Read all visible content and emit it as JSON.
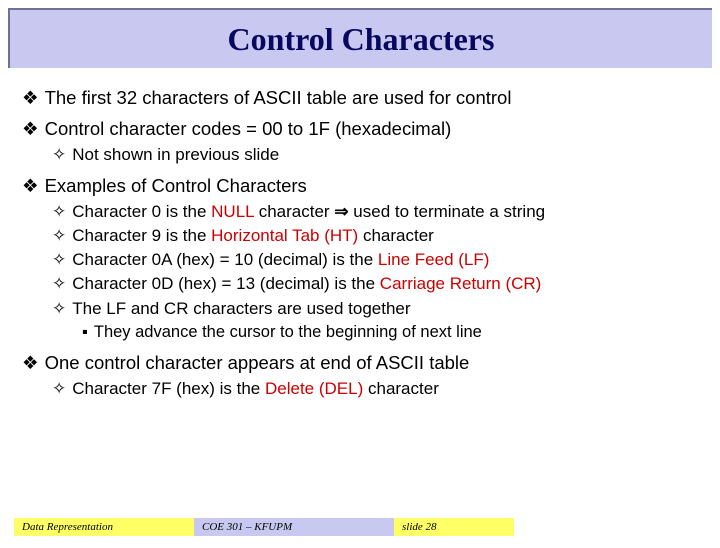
{
  "title": "Control Characters",
  "bullets": {
    "b1_1": "The first 32 characters of ASCII table are used for control",
    "b1_2": "Control character codes = 00 to 1F (hexadecimal)",
    "b2_1": "Not shown in previous slide",
    "b1_3": "Examples of Control Characters",
    "b2_2_a": "Character 0 is the ",
    "b2_2_hl": "NULL",
    "b2_2_b": " character ",
    "b2_2_arrow": "⇒",
    "b2_2_c": " used to terminate a string",
    "b2_3_a": "Character 9 is the ",
    "b2_3_hl": "Horizontal Tab (HT)",
    "b2_3_b": " character",
    "b2_4_a": "Character 0A (hex) = 10 (decimal) is the ",
    "b2_4_hl": "Line Feed (LF)",
    "b2_5_a": "Character 0D (hex) = 13 (decimal) is the ",
    "b2_5_hl": "Carriage Return (CR)",
    "b2_6": "The LF and CR characters are used together",
    "b3_1": "They advance the cursor to the beginning of next line",
    "b1_4": "One control character appears at end of ASCII table",
    "b2_7_a": "Character 7F (hex) is the ",
    "b2_7_hl": "Delete (DEL)",
    "b2_7_b": " character"
  },
  "footer": {
    "left": "Data Representation",
    "center": "COE 301 – KFUPM",
    "right": "slide 28"
  },
  "glyphs": {
    "diamond": "❖",
    "open_diamond": "✧",
    "square": "▪"
  }
}
